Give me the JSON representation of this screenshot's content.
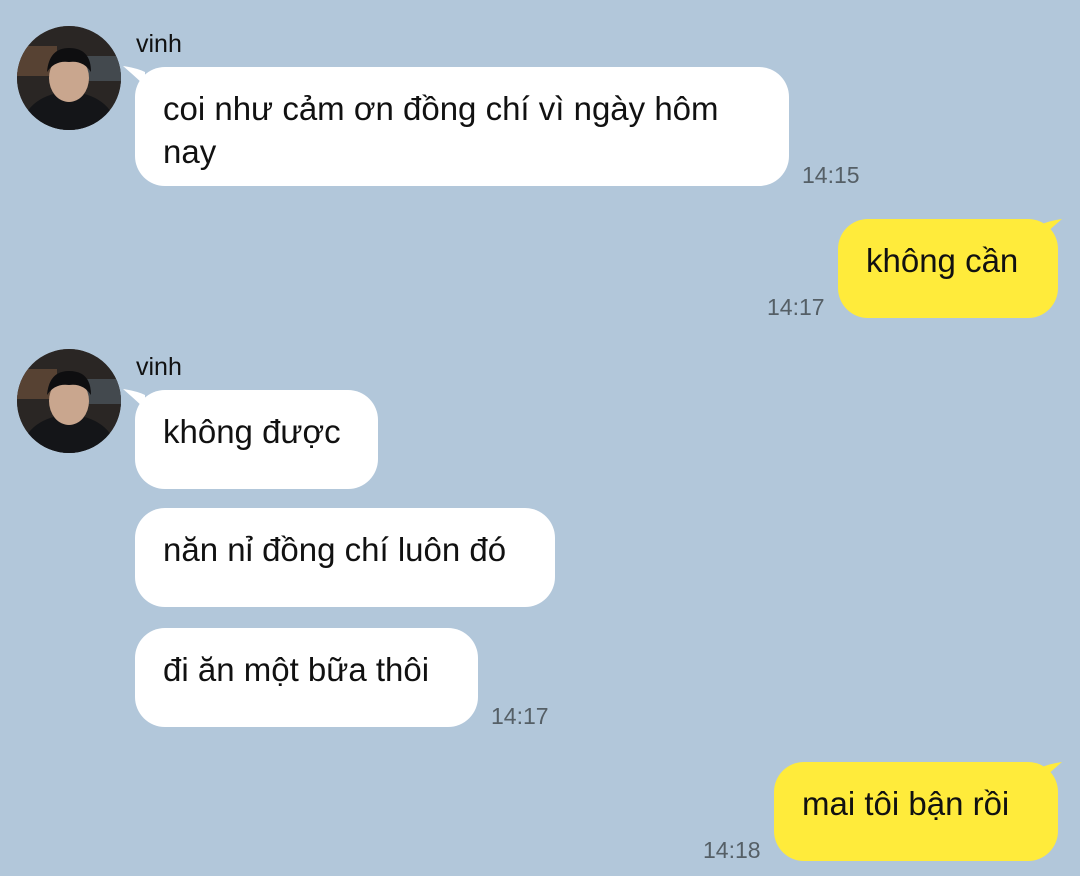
{
  "messages": [
    {
      "sender": "vinh",
      "text": "coi như cảm ơn đồng chí vì ngày hôm nay",
      "time": "14:15"
    },
    {
      "text": "không cần",
      "time": "14:17"
    },
    {
      "sender": "vinh",
      "text": "không được"
    },
    {
      "text": "năn nỉ đồng chí luôn đó"
    },
    {
      "text": "đi ăn một bữa thôi",
      "time": "14:17"
    },
    {
      "text": "mai tôi bận rồi",
      "time": "14:18"
    }
  ],
  "colors": {
    "background": "#b2c7da",
    "incoming_bubble": "#ffffff",
    "outgoing_bubble": "#ffeb3b"
  },
  "icons": {
    "avatar": "profile-photo"
  }
}
